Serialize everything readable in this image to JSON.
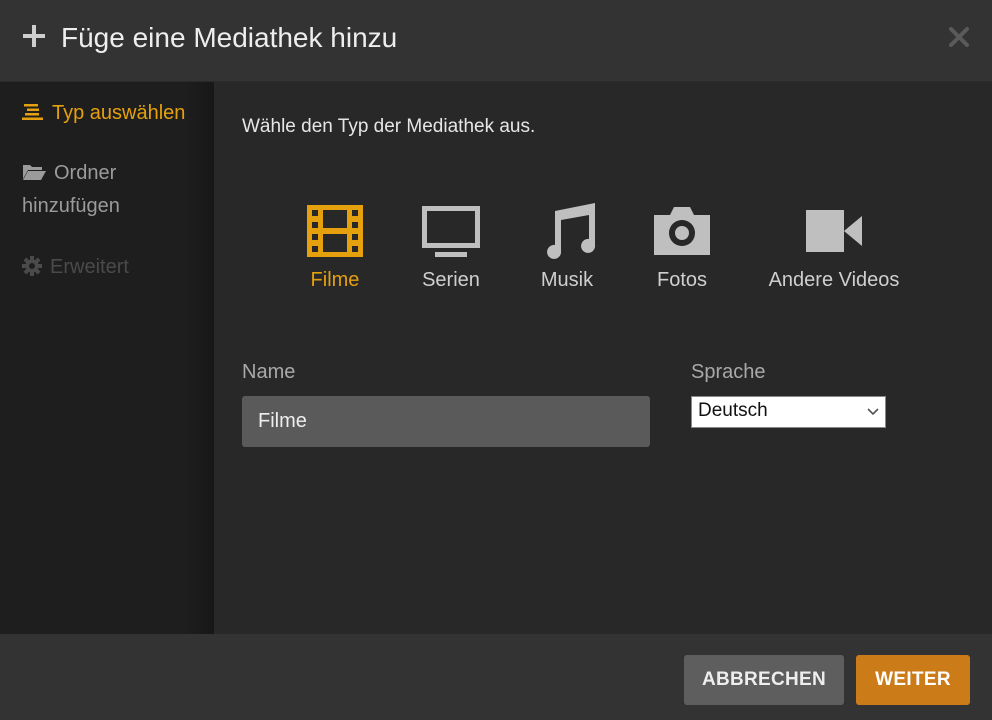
{
  "dialog": {
    "title": "Füge eine Mediathek hinzu",
    "icon": "plus-icon",
    "close_icon": "close-icon"
  },
  "sidebar": {
    "items": [
      {
        "label": "Typ auswählen",
        "icon": "list-icon",
        "state": "active"
      },
      {
        "label": "Ordner hinzufügen",
        "icon": "folder-open-icon",
        "state": "normal"
      },
      {
        "label": "Erweitert",
        "icon": "gear-icon",
        "state": "disabled"
      }
    ],
    "item2_line1": "Ordner",
    "item2_line2": "hinzufügen"
  },
  "main": {
    "instruction": "Wähle den Typ der Mediathek aus.",
    "types": [
      {
        "label": "Filme",
        "icon": "film-icon",
        "selected": true
      },
      {
        "label": "Serien",
        "icon": "tv-icon",
        "selected": false
      },
      {
        "label": "Musik",
        "icon": "music-icon",
        "selected": false
      },
      {
        "label": "Fotos",
        "icon": "camera-icon",
        "selected": false
      },
      {
        "label": "Andere Videos",
        "icon": "video-camera-icon",
        "selected": false
      }
    ],
    "name_label": "Name",
    "name_value": "Filme",
    "language_label": "Sprache",
    "language_value": "Deutsch"
  },
  "footer": {
    "cancel_label": "ABBRECHEN",
    "next_label": "WEITER"
  },
  "colors": {
    "accent": "#e5a00d",
    "button_primary": "#cc7b19",
    "button_secondary": "#5e5e5e",
    "background": "#282828",
    "header": "#333333",
    "sidebar": "#1e1e1e"
  }
}
